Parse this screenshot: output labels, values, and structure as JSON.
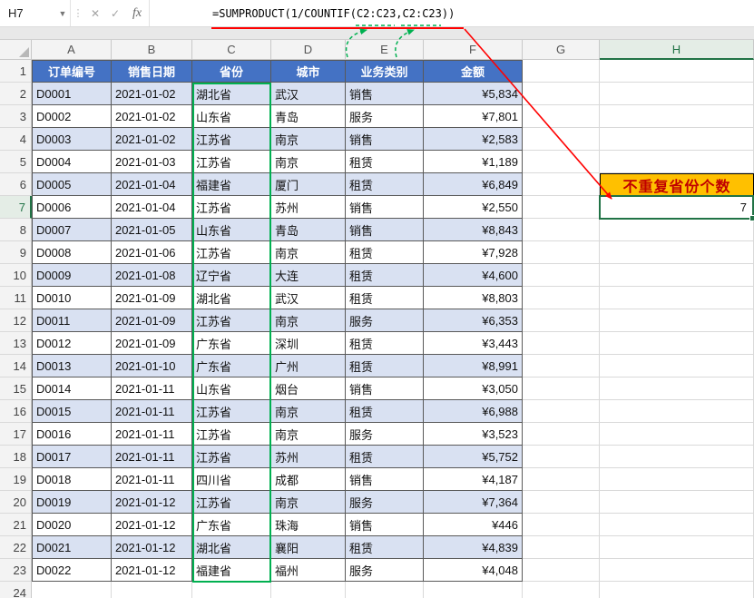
{
  "formula_bar": {
    "name_box": "H7",
    "cancel_label": "✕",
    "enter_label": "✓",
    "fx_label": "fx",
    "formula": "=SUMPRODUCT(1/COUNTIF(C2:C23,C2:C23))"
  },
  "sheet": {
    "column_letters": [
      "A",
      "B",
      "C",
      "D",
      "E",
      "F",
      "G",
      "H"
    ],
    "selected_column": "H",
    "selected_row": 7,
    "row_count": 24,
    "selected_cell": "H7",
    "headers": [
      "订单编号",
      "销售日期",
      "省份",
      "城市",
      "业务类别",
      "金额"
    ],
    "rows": [
      [
        "D0001",
        "2021-01-02",
        "湖北省",
        "武汉",
        "销售",
        "¥5,834"
      ],
      [
        "D0002",
        "2021-01-02",
        "山东省",
        "青岛",
        "服务",
        "¥7,801"
      ],
      [
        "D0003",
        "2021-01-02",
        "江苏省",
        "南京",
        "销售",
        "¥2,583"
      ],
      [
        "D0004",
        "2021-01-03",
        "江苏省",
        "南京",
        "租赁",
        "¥1,189"
      ],
      [
        "D0005",
        "2021-01-04",
        "福建省",
        "厦门",
        "租赁",
        "¥6,849"
      ],
      [
        "D0006",
        "2021-01-04",
        "江苏省",
        "苏州",
        "销售",
        "¥2,550"
      ],
      [
        "D0007",
        "2021-01-05",
        "山东省",
        "青岛",
        "销售",
        "¥8,843"
      ],
      [
        "D0008",
        "2021-01-06",
        "江苏省",
        "南京",
        "租赁",
        "¥7,928"
      ],
      [
        "D0009",
        "2021-01-08",
        "辽宁省",
        "大连",
        "租赁",
        "¥4,600"
      ],
      [
        "D0010",
        "2021-01-09",
        "湖北省",
        "武汉",
        "租赁",
        "¥8,803"
      ],
      [
        "D0011",
        "2021-01-09",
        "江苏省",
        "南京",
        "服务",
        "¥6,353"
      ],
      [
        "D0012",
        "2021-01-09",
        "广东省",
        "深圳",
        "租赁",
        "¥3,443"
      ],
      [
        "D0013",
        "2021-01-10",
        "广东省",
        "广州",
        "租赁",
        "¥8,991"
      ],
      [
        "D0014",
        "2021-01-11",
        "山东省",
        "烟台",
        "销售",
        "¥3,050"
      ],
      [
        "D0015",
        "2021-01-11",
        "江苏省",
        "南京",
        "租赁",
        "¥6,988"
      ],
      [
        "D0016",
        "2021-01-11",
        "江苏省",
        "南京",
        "服务",
        "¥3,523"
      ],
      [
        "D0017",
        "2021-01-11",
        "江苏省",
        "苏州",
        "租赁",
        "¥5,752"
      ],
      [
        "D0018",
        "2021-01-11",
        "四川省",
        "成都",
        "销售",
        "¥4,187"
      ],
      [
        "D0019",
        "2021-01-12",
        "江苏省",
        "南京",
        "服务",
        "¥7,364"
      ],
      [
        "D0020",
        "2021-01-12",
        "广东省",
        "珠海",
        "销售",
        "¥446"
      ],
      [
        "D0021",
        "2021-01-12",
        "湖北省",
        "襄阳",
        "租赁",
        "¥4,839"
      ],
      [
        "D0022",
        "2021-01-12",
        "福建省",
        "福州",
        "服务",
        "¥4,048"
      ]
    ]
  },
  "right_panel": {
    "h6_label": "不重复省份个数",
    "h7_value": "7"
  },
  "colors": {
    "table_header_bg": "#4472C4",
    "band_bg": "#D9E1F2",
    "h6_bg": "#FFC000",
    "h6_text": "#C00000",
    "selection_green": "#217346",
    "range_green": "#00B050",
    "annotation_red": "#FF0000"
  }
}
